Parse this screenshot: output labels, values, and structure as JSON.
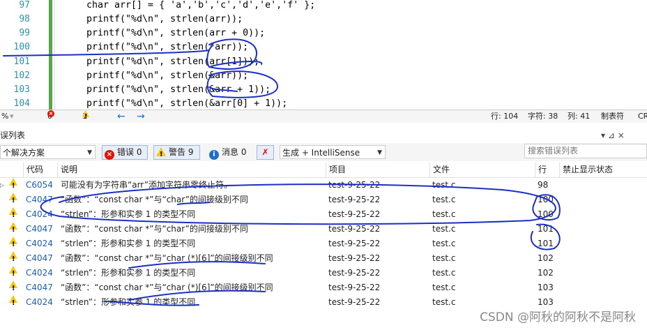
{
  "editor": {
    "lines": [
      {
        "num": "97",
        "text": "char arr[] = { 'a','b','c','d','e','f' };"
      },
      {
        "num": "98",
        "text": "printf(\"%d\\n\", strlen(arr));"
      },
      {
        "num": "99",
        "text": "printf(\"%d\\n\", strlen(arr + 0));"
      },
      {
        "num": "100",
        "text": "printf(\"%d\\n\", strlen(*arr));"
      },
      {
        "num": "101",
        "text": "printf(\"%d\\n\", strlen(arr[1]));"
      },
      {
        "num": "102",
        "text": "printf(\"%d\\n\", strlen(&arr));"
      },
      {
        "num": "103",
        "text": "printf(\"%d\\n\", strlen(&arr + 1));"
      },
      {
        "num": "104",
        "text": "printf(\"%d\\n\", strlen(&arr[0] + 1));"
      }
    ]
  },
  "status": {
    "zoom": "%",
    "errors": "0",
    "warnings": "1",
    "row": "行: 104",
    "char": "字符: 38",
    "col": "列: 41",
    "tab": "制表符",
    "crlf": "CR"
  },
  "panel": {
    "title": "误列表",
    "pin": "▾ ⊿ ×"
  },
  "toolbar": {
    "scope": "个解决方案",
    "errors_label": "错误 0",
    "warnings_label": "警告 9",
    "messages_label": "消息 0",
    "build_filter": "生成 + IntelliSense",
    "search_placeholder": "搜索错误列表"
  },
  "table": {
    "headers": [
      "代码",
      "说明",
      "项目",
      "文件",
      "行",
      "禁止显示状态"
    ],
    "rows": [
      {
        "code": "C6054",
        "desc": "可能没有为字符串“arr”添加字符串零终止符。",
        "project": "test-9-25-22",
        "file": "test.c",
        "line": "98",
        "expand": true
      },
      {
        "code": "C4047",
        "desc": "“函数”：“const char *”与“char”的间接级别不同",
        "project": "test-9-25-22",
        "file": "test.c",
        "line": "100"
      },
      {
        "code": "C4024",
        "desc": "“strlen”：形参和实参 1 的类型不同",
        "project": "test-9-25-22",
        "file": "test.c",
        "line": "100"
      },
      {
        "code": "C4047",
        "desc": "“函数”：“const char *”与“char”的间接级别不同",
        "project": "test-9-25-22",
        "file": "test.c",
        "line": "101"
      },
      {
        "code": "C4024",
        "desc": "“strlen”：形参和实参 1 的类型不同",
        "project": "test-9-25-22",
        "file": "test.c",
        "line": "101"
      },
      {
        "code": "C4047",
        "desc": "“函数”：“const char *”与“char (*)[6]”的间接级别不同",
        "project": "test-9-25-22",
        "file": "test.c",
        "line": "102"
      },
      {
        "code": "C4024",
        "desc": "“strlen”：形参和实参 1 的类型不同",
        "project": "test-9-25-22",
        "file": "test.c",
        "line": "102"
      },
      {
        "code": "C4047",
        "desc": "“函数”：“const char *”与“char (*)[6]”的间接级别不同",
        "project": "test-9-25-22",
        "file": "test.c",
        "line": "103"
      },
      {
        "code": "C4024",
        "desc": "“strlen”：形参和实参 1 的类型不同",
        "project": "test-9-25-22",
        "file": "test.c",
        "line": "103"
      }
    ]
  },
  "watermark": "CSDN @阿秋的阿秋不是阿秋",
  "colors": {
    "accent": "#1a5fb4",
    "annotation": "#1c2fc4",
    "gutter_green": "#57a64a"
  }
}
